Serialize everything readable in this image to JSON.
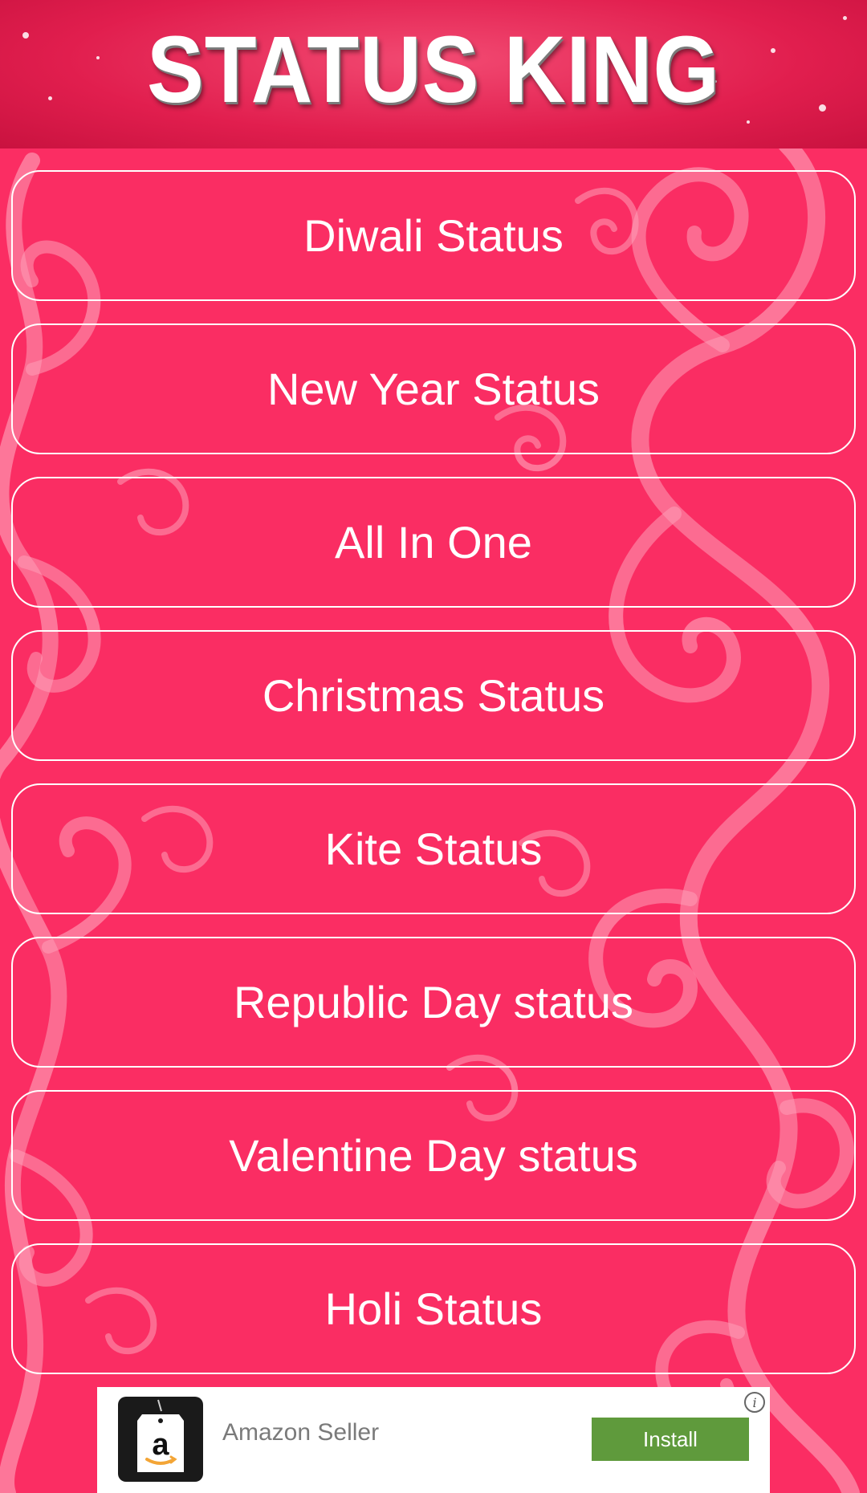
{
  "app": {
    "title": "STATUS KING"
  },
  "menu": {
    "items": [
      {
        "label": "Diwali Status"
      },
      {
        "label": "New Year Status"
      },
      {
        "label": "All In One"
      },
      {
        "label": "Christmas Status"
      },
      {
        "label": "Kite Status"
      },
      {
        "label": "Republic Day status"
      },
      {
        "label": "Valentine Day status"
      },
      {
        "label": "Holi Status"
      }
    ]
  },
  "ad": {
    "name": "Amazon Seller",
    "install_label": "Install",
    "info_glyph": "i",
    "logo_icon": "amazon-logo-icon"
  },
  "colors": {
    "background": "#fb2d63",
    "swirl": "#ffb3c6",
    "button_border": "#ffffff",
    "install_button": "#5f9a3c"
  }
}
